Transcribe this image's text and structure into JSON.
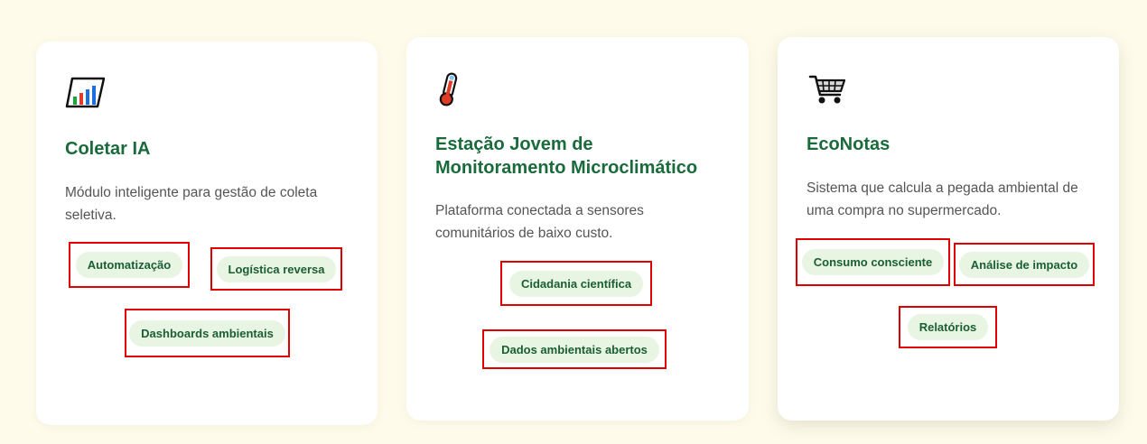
{
  "cards": [
    {
      "icon": "bar-chart-icon",
      "title": "Coletar IA",
      "description": "Módulo inteligente para gestão de coleta seletiva.",
      "tags": [
        "Automatização",
        "Logística reversa",
        "Dashboards ambientais"
      ]
    },
    {
      "icon": "thermometer-icon",
      "title": "Estação Jovem de Monitoramento Microclimático",
      "description": "Plataforma conectada a sensores comunitários de baixo custo.",
      "tags": [
        "Cidadania científica",
        "Dados ambientais abertos"
      ]
    },
    {
      "icon": "shopping-cart-icon",
      "title": "EcoNotas",
      "description": "Sistema que calcula a pegada ambiental de uma compra no supermercado.",
      "tags": [
        "Consumo consciente",
        "Análise de impacto",
        "Relatórios"
      ]
    }
  ],
  "colors": {
    "background": "#fffbeb",
    "title": "#1a6b3c",
    "tag_bg": "#e8f5e3",
    "tag_text": "#1a5e33",
    "highlight_border": "#e00000"
  }
}
